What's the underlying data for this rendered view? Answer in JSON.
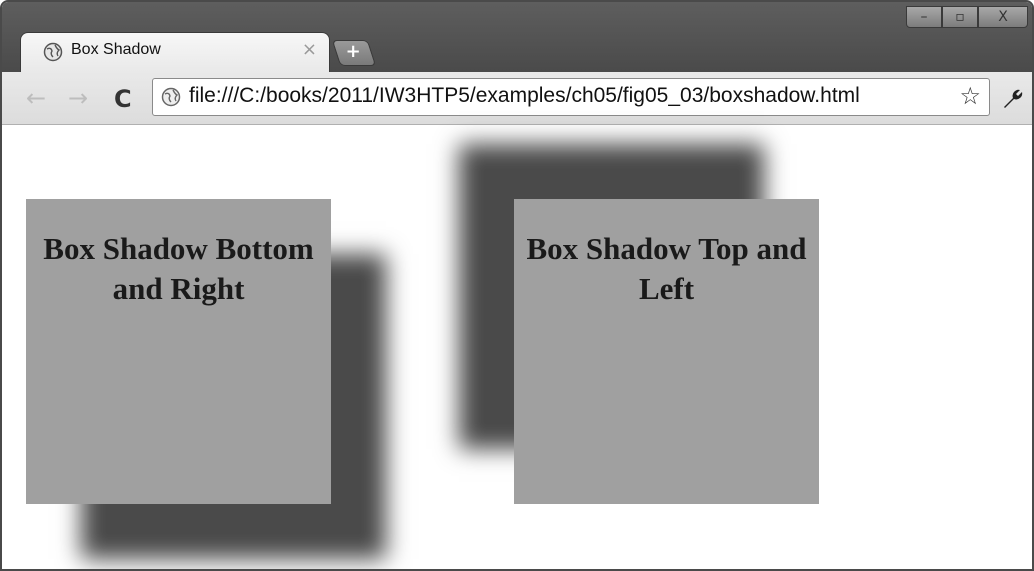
{
  "browser": {
    "tab_title": "Box Shadow",
    "tab_close": "×",
    "new_tab": "+",
    "url": "file:///C:/books/2011/IW3HTP5/examples/ch05/fig05_03/boxshadow.html",
    "window_controls": {
      "minimize": "–",
      "maximize": "▫",
      "close": "X"
    },
    "nav": {
      "back": "←",
      "forward": "→",
      "reload": "C",
      "bookmark": "☆",
      "wrench": "🔧"
    }
  },
  "page": {
    "box1_text": "Box Shadow Bottom and Right",
    "box2_text": "Box Shadow Top and Left"
  },
  "colors": {
    "box_fill": "#a0a0a0",
    "shadow": "#4a4a4a"
  }
}
